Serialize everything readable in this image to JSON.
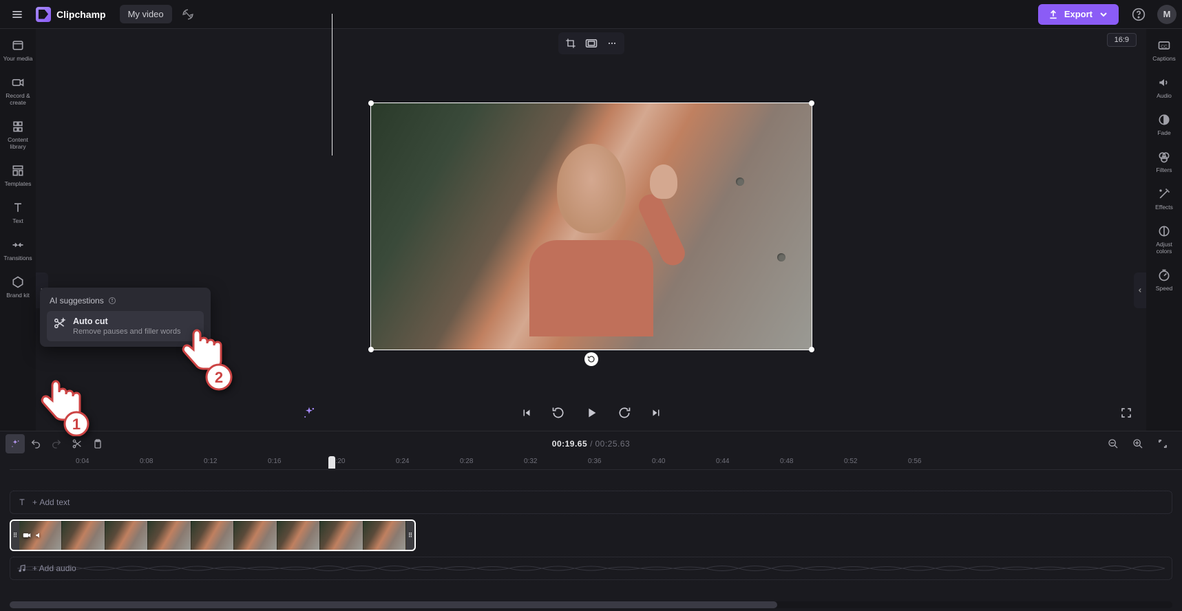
{
  "header": {
    "app_name": "Clipchamp",
    "project_title": "My video",
    "export_label": "Export",
    "avatar_initial": "M"
  },
  "aspect_ratio": "16:9",
  "left_sidebar": {
    "items": [
      {
        "label": "Your media"
      },
      {
        "label": "Record & create"
      },
      {
        "label": "Content library"
      },
      {
        "label": "Templates"
      },
      {
        "label": "Text"
      },
      {
        "label": "Transitions"
      },
      {
        "label": "Brand kit"
      }
    ]
  },
  "right_sidebar": {
    "items": [
      {
        "label": "Captions"
      },
      {
        "label": "Audio"
      },
      {
        "label": "Fade"
      },
      {
        "label": "Filters"
      },
      {
        "label": "Effects"
      },
      {
        "label": "Adjust colors"
      },
      {
        "label": "Speed"
      }
    ]
  },
  "ai_popup": {
    "title": "AI suggestions",
    "option_title": "Auto cut",
    "option_desc": "Remove pauses and filler words"
  },
  "playback": {
    "current_time": "00:19.65",
    "separator": "/",
    "total_time": "00:25.63"
  },
  "ruler_ticks": [
    "0:04",
    "0:08",
    "0:12",
    "0:16",
    "0:20",
    "0:24",
    "0:28",
    "0:32",
    "0:36",
    "0:40",
    "0:44",
    "0:48",
    "0:52",
    "0:56"
  ],
  "tracks": {
    "text_track_label": "Add text",
    "audio_track_label": "+ Add audio"
  },
  "hand_labels": {
    "one": "1",
    "two": "2"
  }
}
